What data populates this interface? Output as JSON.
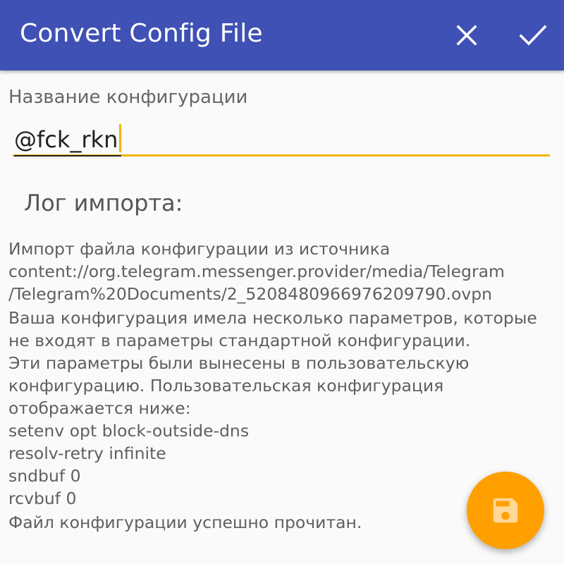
{
  "appbar": {
    "title": "Convert Config File",
    "close_icon": "close-icon",
    "confirm_icon": "check-icon",
    "color": "#3f51b5"
  },
  "form": {
    "name_label": "Название конфигурации",
    "name_value": "@fck_rkn",
    "accent_color": "#f4b400"
  },
  "log": {
    "title": "Лог импорта:",
    "paragraphs": [
      [
        "Импорт файла конфигурации из источника",
        "content://org.telegram.messenger.provider/media/Telegram",
        "/Telegram%20Documents/2_5208480966976209790.ovpn"
      ],
      [
        "Ваша конфигурация имела несколько параметров, которые",
        "не входят в параметры стандартной конфигурации.",
        "Эти параметры были вынесены в пользовательскую",
        "конфигурацию. Пользовательская конфигурация",
        "отображается ниже:",
        "setenv opt block-outside-dns",
        "resolv-retry infinite",
        "sndbuf 0",
        "rcvbuf 0"
      ]
    ],
    "final": "Файл конфигурации успешно прочитан."
  },
  "fab": {
    "icon": "save-icon",
    "color": "#ffa000"
  }
}
